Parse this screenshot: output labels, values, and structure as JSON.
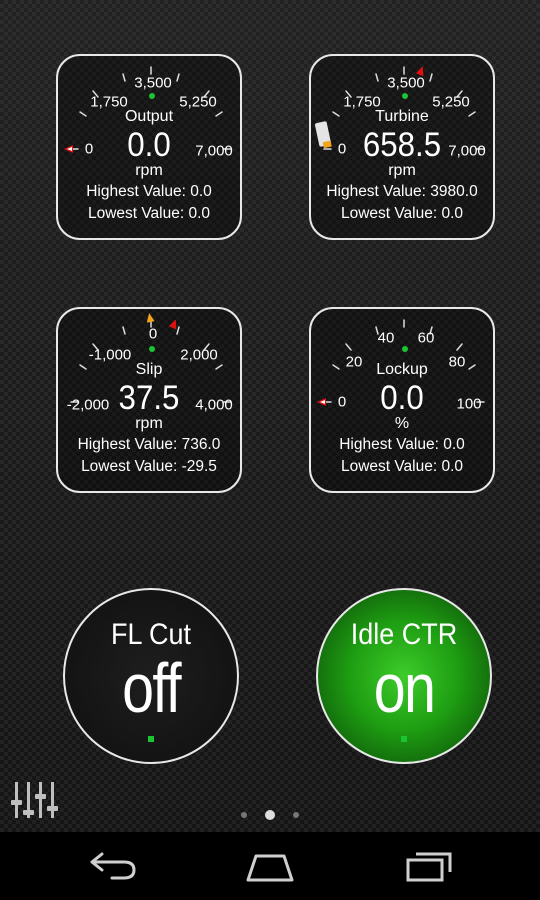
{
  "colors": {
    "accent_green": "#19c532",
    "marker_red": "#e01010",
    "marker_orange": "#f2a51b",
    "toggle_on": "#1e9d12"
  },
  "gauges": [
    {
      "name": "Output",
      "value": "0.0",
      "unit": "rpm",
      "highest": "Highest Value: 0.0",
      "lowest": "Lowest Value: 0.0",
      "ticks": [
        "0",
        "1,750",
        "3,500",
        "5,250",
        "7,000"
      ],
      "fill_fraction": 0,
      "markers": [
        "min-marker-red"
      ]
    },
    {
      "name": "Turbine",
      "value": "658.5",
      "unit": "rpm",
      "highest": "Highest Value: 3980.0",
      "lowest": "Lowest Value: 0.0",
      "ticks": [
        "0",
        "1,750",
        "3,500",
        "5,250",
        "7,000"
      ],
      "fill_fraction": 0.094,
      "markers": [
        "max-marker-red"
      ]
    },
    {
      "name": "Slip",
      "value": "37.5",
      "unit": "rpm",
      "highest": "Highest Value: 736.0",
      "lowest": "Lowest Value: -29.5",
      "ticks": [
        "-2,000",
        "-1,000",
        "0",
        "2,000",
        "4,000"
      ],
      "fill_fraction": 0.34,
      "markers": [
        "min-marker-orange",
        "max-marker-red"
      ]
    },
    {
      "name": "Lockup",
      "value": "0.0",
      "unit": "%",
      "highest": "Highest Value: 0.0",
      "lowest": "Lowest Value: 0.0",
      "ticks": [
        "0",
        "20",
        "40",
        "60",
        "80",
        "100"
      ],
      "fill_fraction": 0,
      "markers": [
        "min-marker-red"
      ]
    }
  ],
  "toggles": [
    {
      "label": "FL Cut",
      "state": "off"
    },
    {
      "label": "Idle CTR",
      "state": "on"
    }
  ],
  "icons": {
    "settings": "sliders-icon",
    "back": "back-icon",
    "home": "home-icon",
    "recents": "recents-icon"
  },
  "page_indicator": {
    "current": 2,
    "total": 3
  }
}
